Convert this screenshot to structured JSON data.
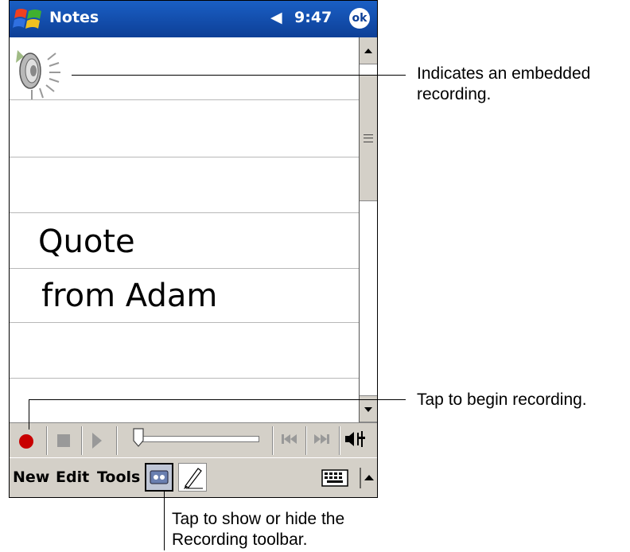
{
  "titlebar": {
    "app_title": "Notes",
    "speaker_status": "◀",
    "clock": "9:47",
    "ok_label": "ok",
    "icons": [
      "windows-start-flag-icon",
      "speaker-icon",
      "ok-icon"
    ]
  },
  "note": {
    "lines": [
      "Quote",
      "from Adam"
    ],
    "embedded_item": "recording-speaker-icon"
  },
  "recording_toolbar": {
    "buttons": [
      "record",
      "stop",
      "play",
      "skip-back",
      "skip-forward",
      "volume"
    ],
    "record_color": "#c80000"
  },
  "menubar": {
    "new_label": "New",
    "edit_label": "Edit",
    "tools_label": "Tools"
  },
  "callouts": {
    "embedded_line1": "Indicates an embedded",
    "embedded_line2": "recording.",
    "record": "Tap to begin recording.",
    "toggle_line1": "Tap to show or hide the",
    "toggle_line2": "Recording toolbar."
  },
  "colors": {
    "titlebar": "#0d3f97",
    "toolbar": "#d4d0c8",
    "rule": "#b8b8b8"
  }
}
